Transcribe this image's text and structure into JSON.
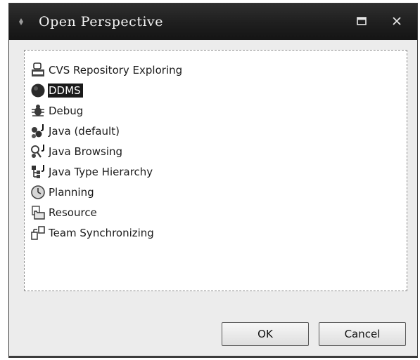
{
  "dialog": {
    "title": "Open Perspective",
    "title_controls": {
      "maximize_icon": "maximize-icon",
      "close_icon": "close-icon"
    },
    "perspectives": [
      {
        "label": "CVS Repository Exploring",
        "icon": "cvs-repository-icon",
        "selected": false
      },
      {
        "label": "DDMS",
        "icon": "ddms-icon",
        "selected": true
      },
      {
        "label": "Debug",
        "icon": "debug-icon",
        "selected": false
      },
      {
        "label": "Java (default)",
        "icon": "java-perspective-icon",
        "selected": false
      },
      {
        "label": "Java Browsing",
        "icon": "java-browsing-icon",
        "selected": false
      },
      {
        "label": "Java Type Hierarchy",
        "icon": "java-type-hierarchy-icon",
        "selected": false
      },
      {
        "label": "Planning",
        "icon": "planning-icon",
        "selected": false
      },
      {
        "label": "Resource",
        "icon": "resource-icon",
        "selected": false
      },
      {
        "label": "Team Synchronizing",
        "icon": "team-synchronizing-icon",
        "selected": false
      }
    ],
    "buttons": {
      "ok_label": "OK",
      "cancel_label": "Cancel"
    }
  },
  "colors": {
    "titlebar": "#1e1e1e",
    "selection": "#1a1a1a",
    "list_background": "#ffffff",
    "dialog_background": "#ececec"
  }
}
